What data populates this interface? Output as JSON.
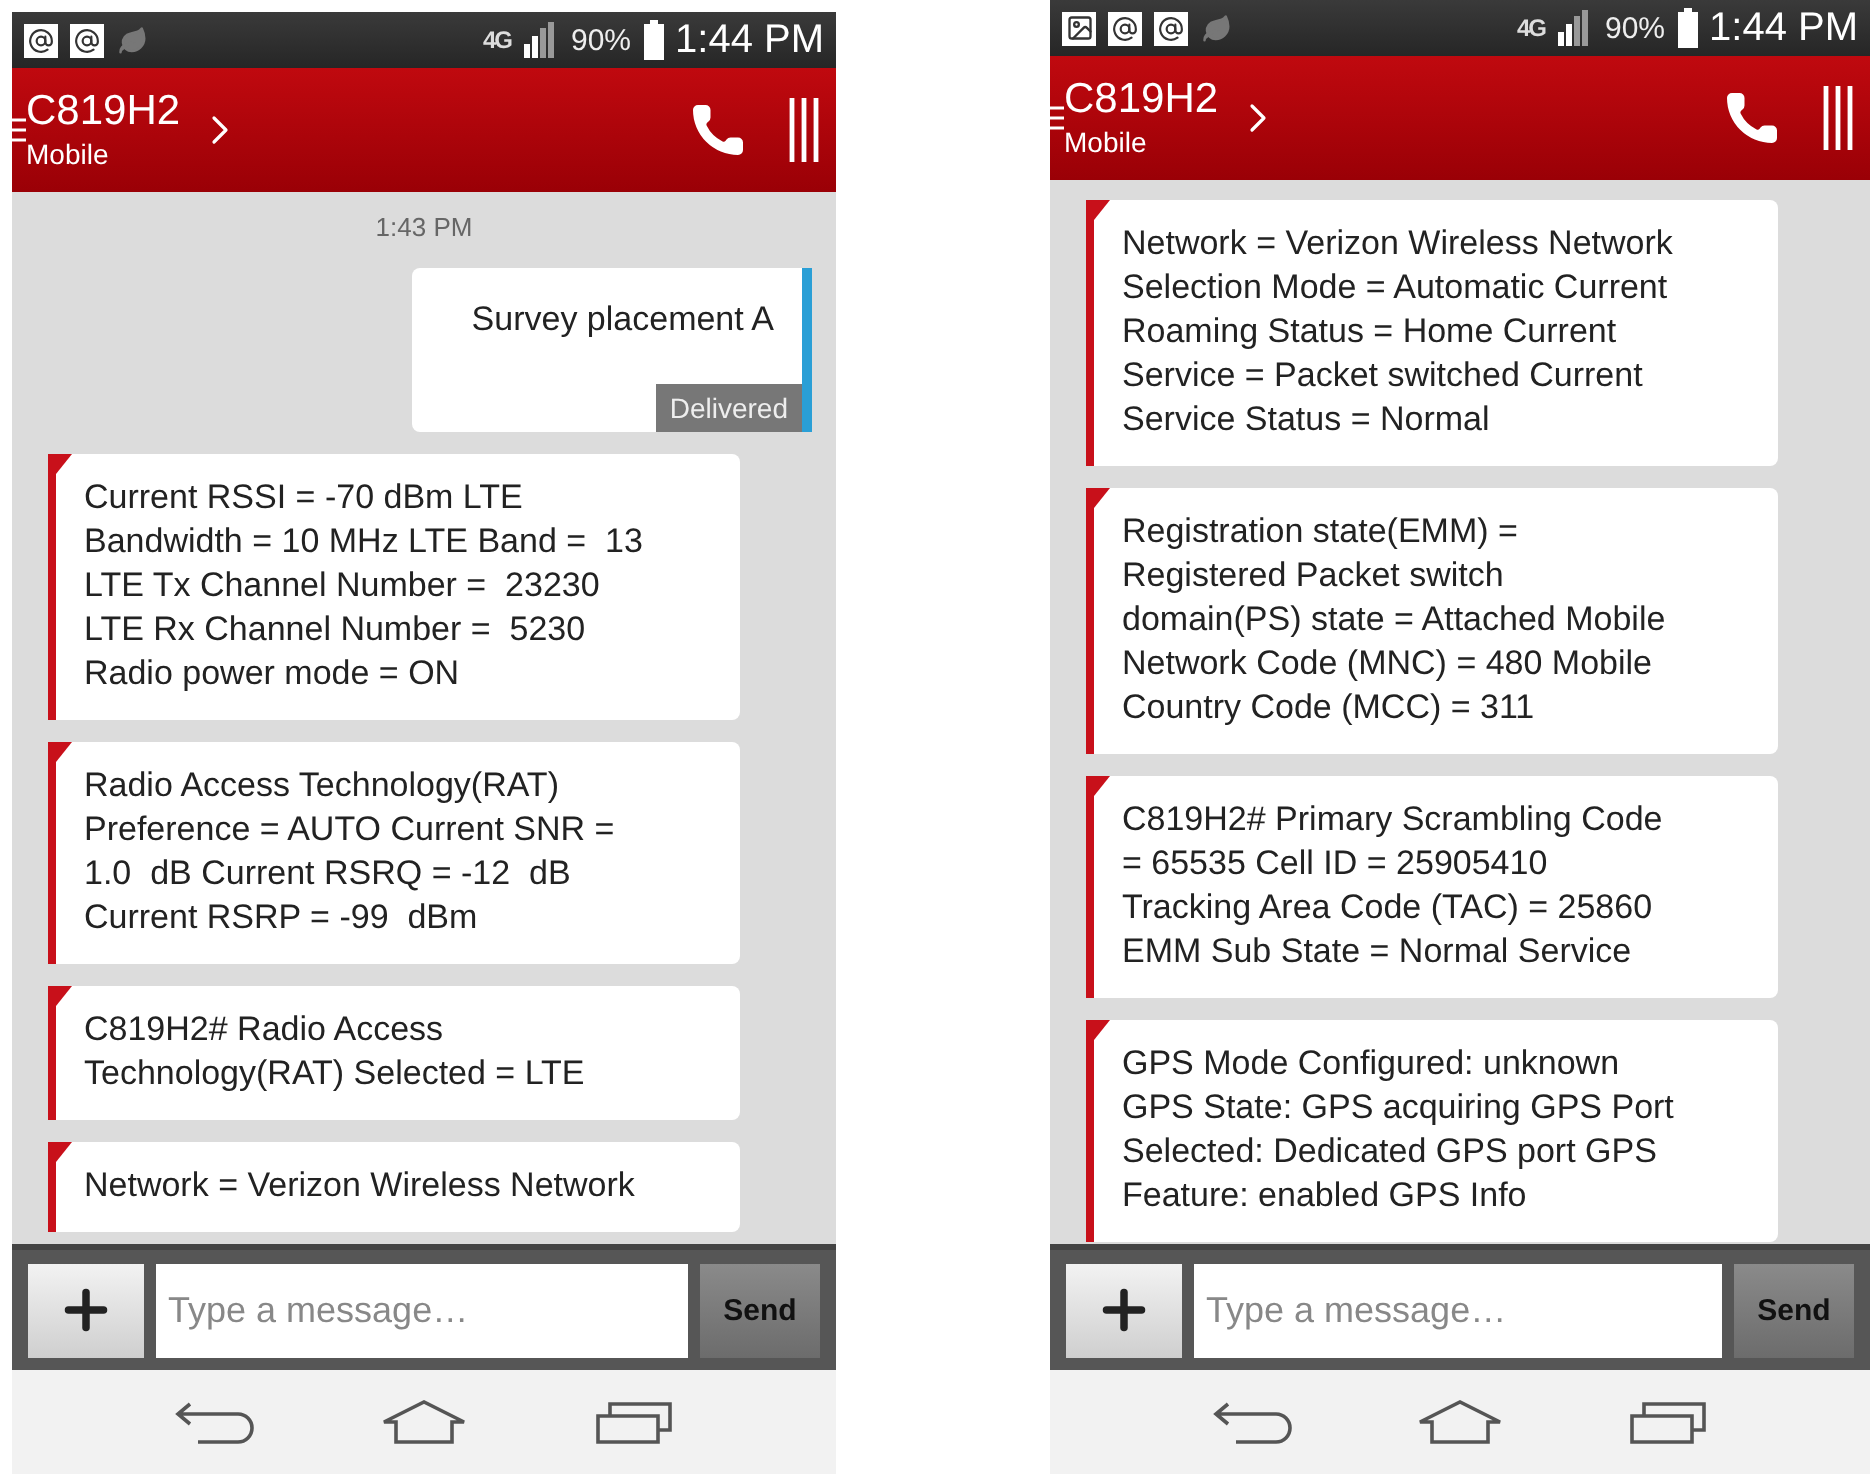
{
  "phones": [
    {
      "status_bar": {
        "notifications": [
          {
            "kind": "at"
          },
          {
            "kind": "at"
          },
          {
            "kind": "leaf"
          }
        ],
        "network": "4G",
        "battery": "90%",
        "time": "1:44 PM"
      },
      "header": {
        "title": "C819H2",
        "subtitle": "Mobile"
      },
      "messages": [
        {
          "kind": "timestamp",
          "text": "1:43 PM"
        },
        {
          "kind": "outgoing",
          "lines": [
            "Survey placement A"
          ],
          "status": "Delivered"
        },
        {
          "kind": "incoming",
          "lines": [
            "Current RSSI = -70 dBm LTE",
            "Bandwidth = 10 MHz LTE Band =  13",
            "LTE Tx Channel Number =  23230",
            "LTE Rx Channel Number =  5230",
            "Radio power mode = ON"
          ]
        },
        {
          "kind": "incoming",
          "lines": [
            "Radio Access Technology(RAT)",
            "Preference = AUTO Current SNR =",
            "1.0  dB Current RSRQ = -12  dB",
            "Current RSRP = -99  dBm"
          ]
        },
        {
          "kind": "incoming",
          "lines": [
            "C819H2# Radio Access",
            "Technology(RAT) Selected = LTE"
          ]
        },
        {
          "kind": "incoming",
          "lines": [
            "Network = Verizon Wireless Network"
          ]
        }
      ],
      "composer": {
        "placeholder": "Type a message…",
        "send": "Send"
      }
    },
    {
      "status_bar": {
        "notifications": [
          {
            "kind": "image"
          },
          {
            "kind": "at"
          },
          {
            "kind": "at"
          },
          {
            "kind": "leaf"
          }
        ],
        "network": "4G",
        "battery": "90%",
        "time": "1:44 PM"
      },
      "header": {
        "title": "C819H2",
        "subtitle": "Mobile"
      },
      "messages": [
        {
          "kind": "incoming",
          "lines": [
            "Network = Verizon Wireless Network",
            "Selection Mode = Automatic Current",
            "Roaming Status = Home Current",
            "Service = Packet switched Current",
            "Service Status = Normal"
          ]
        },
        {
          "kind": "incoming",
          "lines": [
            "Registration state(EMM) =",
            "Registered Packet switch",
            "domain(PS) state = Attached Mobile",
            "Network Code (MNC) = 480 Mobile",
            "Country Code (MCC) = 311"
          ]
        },
        {
          "kind": "incoming",
          "lines": [
            "C819H2# Primary Scrambling Code",
            "= 65535 Cell ID = 25905410",
            "Tracking Area Code (TAC) = 25860",
            "EMM Sub State = Normal Service"
          ]
        },
        {
          "kind": "incoming",
          "lines": [
            "GPS Mode Configured: unknown",
            "GPS State: GPS acquiring GPS Port",
            "Selected: Dedicated GPS port GPS",
            "Feature: enabled GPS Info"
          ]
        }
      ],
      "composer": {
        "placeholder": "Type a message…",
        "send": "Send"
      }
    }
  ]
}
